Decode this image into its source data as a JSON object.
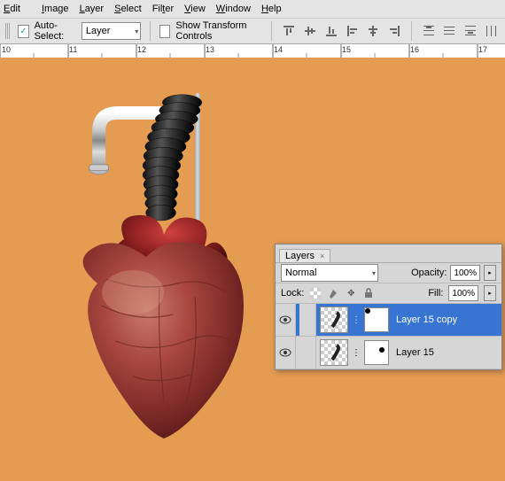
{
  "menu": {
    "edit": "Edit",
    "image": "Image",
    "layer": "Layer",
    "select": "Select",
    "filter": "Filter",
    "view": "View",
    "window": "Window",
    "help": "Help"
  },
  "toolbar": {
    "auto_select": "Auto-Select:",
    "auto_select_mode": "Layer",
    "show_transform": "Show Transform Controls"
  },
  "ruler": {
    "marks": [
      "10",
      "11",
      "12",
      "13",
      "14",
      "15",
      "16",
      "17"
    ]
  },
  "layers_panel": {
    "tab": "Layers",
    "blend_mode": "Normal",
    "opacity_label": "Opacity:",
    "opacity_value": "100%",
    "lock_label": "Lock:",
    "fill_label": "Fill:",
    "fill_value": "100%",
    "rows": [
      {
        "name": "Layer 15 copy",
        "selected": true
      },
      {
        "name": "Layer 15",
        "selected": false
      }
    ]
  }
}
